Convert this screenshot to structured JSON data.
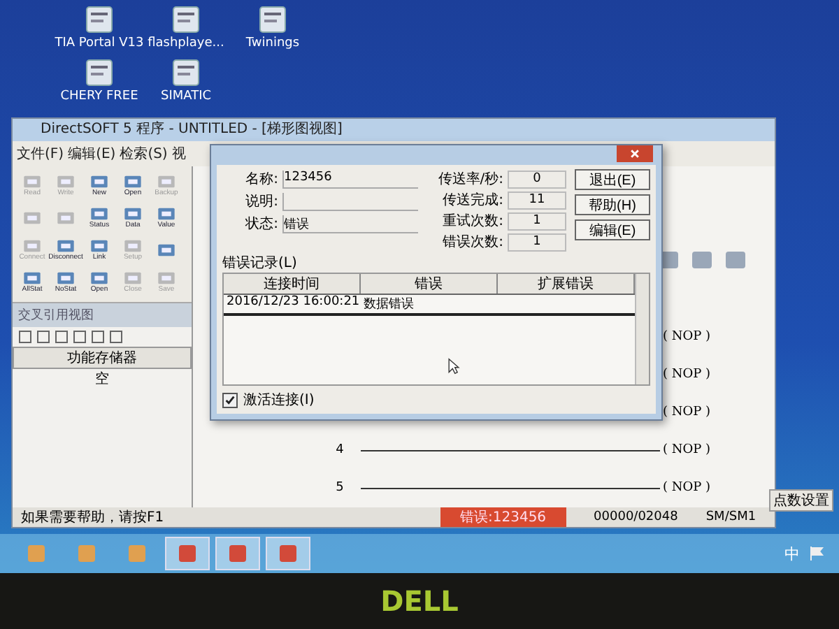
{
  "desktop_icons": [
    {
      "label": "TIA Portal V13"
    },
    {
      "label": "flashplaye..."
    },
    {
      "label": "Twinings"
    },
    {
      "label": "CHERY FREE"
    },
    {
      "label": "SIMATIC"
    }
  ],
  "main_window": {
    "title": "DirectSOFT 5 程序 - UNTITLED - [梯形图视图]",
    "menu": [
      "文件(F)",
      "编辑(E)",
      "检索(S)",
      "视"
    ],
    "toolbar": [
      {
        "label": "Read",
        "disabled": true
      },
      {
        "label": "Write",
        "disabled": true
      },
      {
        "label": "New",
        "disabled": false
      },
      {
        "label": "Open",
        "disabled": false
      },
      {
        "label": "Backup",
        "disabled": true
      },
      {
        "disabled": true
      },
      {
        "disabled": true
      },
      {
        "label": "Status",
        "disabled": false
      },
      {
        "label": "Data",
        "disabled": false
      },
      {
        "label": "Value",
        "disabled": false
      },
      {
        "label": "Connect",
        "disabled": true
      },
      {
        "label": "Disconnect",
        "disabled": false
      },
      {
        "label": "Link",
        "disabled": false
      },
      {
        "label": "Setup",
        "disabled": true
      },
      {
        "disabled": false
      },
      {
        "label": "AllStat",
        "disabled": false
      },
      {
        "label": "NoStat",
        "disabled": false
      },
      {
        "label": "Open",
        "disabled": false
      },
      {
        "label": "Close",
        "disabled": true
      },
      {
        "label": "Save",
        "disabled": true
      }
    ],
    "cross_reference": {
      "title": "交叉引用视图",
      "column": "功能存储器",
      "row": "空"
    },
    "ladder": {
      "rungs": [
        {
          "coil": "( NOP )"
        },
        {
          "coil": "( NOP )"
        },
        {
          "coil": "( NOP )"
        },
        {
          "number": "4",
          "coil": "( NOP )"
        },
        {
          "number": "5",
          "coil": "( NOP )"
        }
      ]
    },
    "status_bar": {
      "help": "如果需要帮助，请按F1",
      "error": "错误:123456",
      "address": "00000/02048",
      "memory": "SM/SM1"
    },
    "tooltip": "点数设置"
  },
  "dialog": {
    "fields": [
      {
        "label": "名称:",
        "value": "123456"
      },
      {
        "label": "说明:"
      },
      {
        "label": "状态:",
        "value": "错误"
      }
    ],
    "stats": [
      {
        "label": "传送率/秒:",
        "value": "0"
      },
      {
        "label": "传送完成:",
        "value": "11"
      },
      {
        "label": "重试次数:",
        "value": "1"
      },
      {
        "label": "错误次数:",
        "value": "1"
      }
    ],
    "buttons": [
      "退出(E)",
      "帮助(H)",
      "编辑(E)"
    ],
    "log_label": "错误记录(L)",
    "columns": [
      "连接时间",
      "错误",
      "扩展错误"
    ],
    "rows": [
      {
        "selected": true,
        "cells": [
          "2016/12/23 16:00:21",
          "数据错误"
        ]
      }
    ],
    "checkbox": {
      "label": "激活连接(I)",
      "checked": true
    }
  },
  "taskbar": [
    {
      "selected": false
    },
    {
      "selected": false
    },
    {
      "selected": false
    },
    {
      "selected": true
    },
    {
      "selected": true
    },
    {
      "selected": true
    }
  ],
  "tray": [
    "中"
  ],
  "bezel": {
    "logo": "DELL"
  }
}
